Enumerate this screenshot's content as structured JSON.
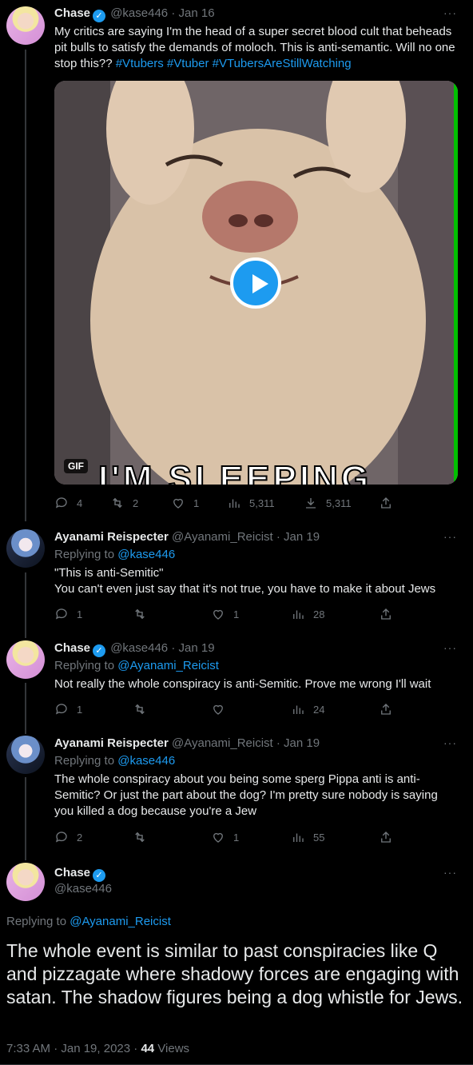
{
  "tweets": [
    {
      "name": "Chase",
      "handle": "@kase446",
      "date": "Jan 16",
      "body_parts": [
        "My critics are saying I'm the head of a super secret blood cult that beheads pit bulls to satisfy the demands of moloch. This is anti-semantic. Will no one stop this?? ",
        "#Vtubers #Vtuber #VTubersAreStillWatching"
      ],
      "media": {
        "badge": "GIF",
        "caption": "I'M SLEEPING"
      },
      "stats": {
        "replies": "4",
        "retweets": "2",
        "likes": "1",
        "views": "5,311",
        "downloads": "5,311"
      }
    },
    {
      "name": "Ayanami Reispecter",
      "handle": "@Ayanami_Reicist",
      "date": "Jan 19",
      "replying_label": "Replying to",
      "replying_to": "@kase446",
      "body_lines": [
        "\"This is anti-Semitic\"",
        "You can't even just say that it's not true, you have to make it about Jews"
      ],
      "stats": {
        "replies": "1",
        "retweets": "",
        "likes": "1",
        "views": "28"
      }
    },
    {
      "name": "Chase",
      "handle": "@kase446",
      "date": "Jan 19",
      "replying_label": "Replying to",
      "replying_to": "@Ayanami_Reicist",
      "body": "Not really the whole conspiracy is anti-Semitic. Prove me wrong I'll wait",
      "stats": {
        "replies": "1",
        "retweets": "",
        "likes": "",
        "views": "24"
      }
    },
    {
      "name": "Ayanami Reispecter",
      "handle": "@Ayanami_Reicist",
      "date": "Jan 19",
      "replying_label": "Replying to",
      "replying_to": "@kase446",
      "body": "The whole conspiracy about you being some sperg Pippa anti is anti-Semitic? Or just the part about the dog? I'm pretty sure nobody is saying you killed a dog because you're a Jew",
      "stats": {
        "replies": "2",
        "retweets": "",
        "likes": "1",
        "views": "55"
      }
    }
  ],
  "main_tweet": {
    "name": "Chase",
    "handle": "@kase446",
    "replying_label": "Replying to",
    "replying_to": "@Ayanami_Reicist",
    "body": "The whole event is similar to past conspiracies like Q and pizzagate where shadowy forces are engaging with satan.  The shadow figures being a dog whistle for Jews.",
    "timestamp": "7:33 AM · Jan 19, 2023 · ",
    "views_count": "44",
    "views_label": "Views"
  },
  "ui": {
    "dot": "·",
    "more": "···"
  }
}
